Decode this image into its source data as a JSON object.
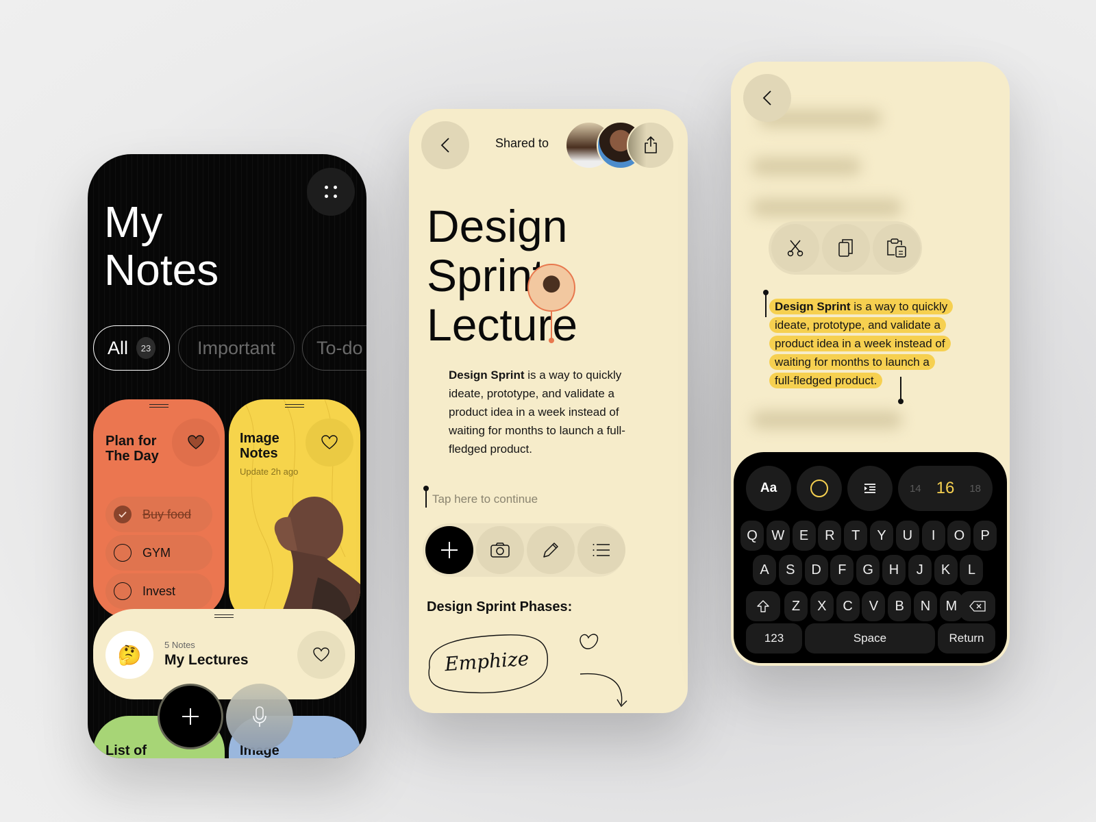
{
  "colors": {
    "orange": "#eb7650",
    "yellow": "#f6d44b",
    "cream": "#f6ecca",
    "green": "#a7d576",
    "blue": "#9ab7dd",
    "highlight": "#f6d050",
    "accent_ring": "#f6d050"
  },
  "notes_list": {
    "title_line1": "My",
    "title_line2": "Notes",
    "menu_icon": "grid-dots-icon",
    "filters": [
      {
        "label": "All",
        "count": "23",
        "active": true
      },
      {
        "label": "Important",
        "active": false
      },
      {
        "label": "To-do",
        "active": false
      }
    ],
    "cards": {
      "plan": {
        "title_line1": "Plan for",
        "title_line2": "The Day",
        "favorited": true,
        "todos": [
          {
            "label": "Buy food",
            "done": true
          },
          {
            "label": "GYM",
            "done": false
          },
          {
            "label": "Invest",
            "done": false
          }
        ]
      },
      "image_notes": {
        "title_line1": "Image",
        "title_line2": "Notes",
        "subtitle": "Update 2h ago",
        "favorited": false
      },
      "lectures": {
        "emoji": "🤔",
        "count_label": "5 Notes",
        "title": "My Lectures",
        "favorited": false
      },
      "list_of": {
        "title": "List of"
      },
      "image2": {
        "title": "Image"
      }
    },
    "fab_add_icon": "plus-icon",
    "fab_mic_icon": "microphone-icon"
  },
  "note_detail": {
    "back_icon": "chevron-left-icon",
    "shared_label": "Shared to",
    "share_icon": "share-icon",
    "title_lines": [
      "Design",
      "Sprint",
      "Lecture"
    ],
    "body_bold": "Design Sprint",
    "body_rest": " is a way to quickly ideate, prototype, and validate a product idea in a week instead of waiting for months to launch a full-fledged product.",
    "input_placeholder": "Tap here to continue",
    "tools": [
      "plus-icon",
      "camera-icon",
      "pencil-icon",
      "list-icon"
    ],
    "section_title": "Design Sprint Phases:",
    "sketch_word": "Emphize"
  },
  "editor": {
    "back_icon": "chevron-left-icon",
    "context_actions": [
      "scissors-icon",
      "copy-icon",
      "paste-icon"
    ],
    "selected_bold": "Design Sprint",
    "selected_lines": [
      " is a way to quickly",
      "ideate, prototype, and validate a",
      "product idea in a week instead of",
      "waiting for months to launch a",
      "full-fledged product."
    ],
    "format_bar": {
      "font_label": "Aa",
      "color_icon": "color-circle-icon",
      "indent_icon": "indent-icon",
      "sizes": [
        "14",
        "16",
        "18"
      ],
      "selected_size": "16"
    },
    "keyboard": {
      "row1": [
        "Q",
        "W",
        "E",
        "R",
        "T",
        "Y",
        "U",
        "I",
        "O",
        "P"
      ],
      "row2": [
        "A",
        "S",
        "D",
        "F",
        "G",
        "H",
        "J",
        "K",
        "L"
      ],
      "row3": [
        "Z",
        "X",
        "C",
        "V",
        "B",
        "N",
        "M"
      ],
      "numbers": "123",
      "space": "Space",
      "return": "Return"
    }
  }
}
